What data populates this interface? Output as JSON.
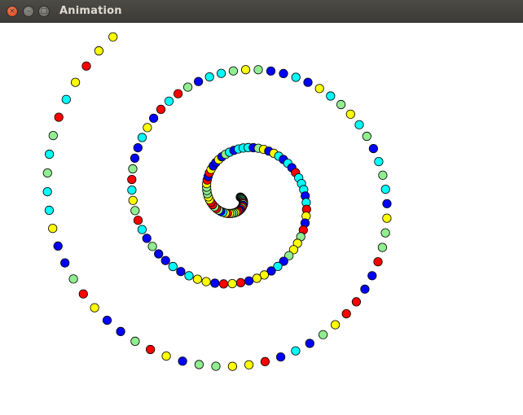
{
  "window": {
    "title": "Animation",
    "close_glyph": "×",
    "minimize_glyph": "–",
    "maximize_glyph": "□"
  },
  "spiral": {
    "dot_count": 170,
    "palette": [
      "#ff0000",
      "#0000ff",
      "#00ffff",
      "#ffff00",
      "#90ee90"
    ],
    "outline_color": "#000000",
    "background": "#ffffff"
  }
}
